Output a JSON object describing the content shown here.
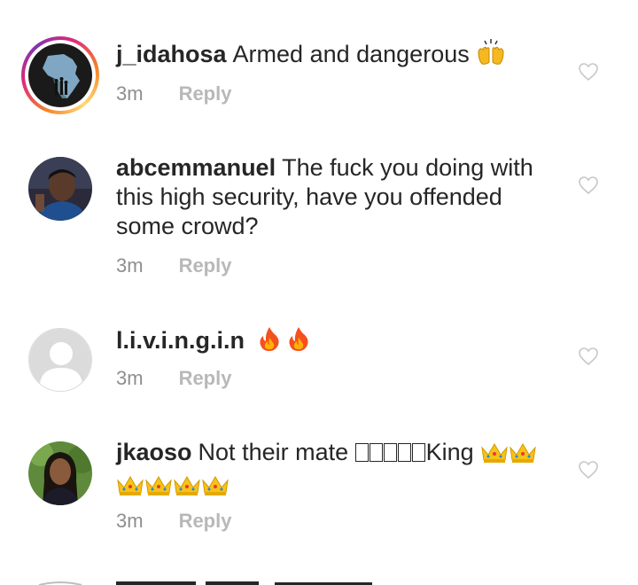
{
  "comments": [
    {
      "username": "j_idahosa",
      "text": "Armed and dangerous",
      "emoji": [
        "raised-hands"
      ],
      "time": "3m",
      "reply_label": "Reply"
    },
    {
      "username": "abcemmanuel",
      "text_lines": [
        "The fuck you doing with",
        "this high security, have you offended",
        "some crowd?"
      ],
      "time": "3m",
      "reply_label": "Reply"
    },
    {
      "username": "l.i.v.i.n.g.i.n",
      "text": "",
      "emoji": [
        "fire",
        "fire"
      ],
      "time": "3m",
      "reply_label": "Reply"
    },
    {
      "username": "jkaoso",
      "text": "Not their mate",
      "text_after": "King",
      "emoji": [
        "crown",
        "crown",
        "crown",
        "crown",
        "crown",
        "crown"
      ],
      "time": "3m",
      "reply_label": "Reply"
    }
  ],
  "colors": {
    "text": "#262626",
    "meta": "#8e8e8e",
    "reply": "#b8b8b8",
    "heart": "#c7c7c7",
    "story_ring": [
      "#f58529",
      "#dd2a7b",
      "#8134af",
      "#feda77"
    ]
  },
  "icons": {
    "like": "heart-outline-icon",
    "default_avatar": "default-avatar-icon"
  }
}
